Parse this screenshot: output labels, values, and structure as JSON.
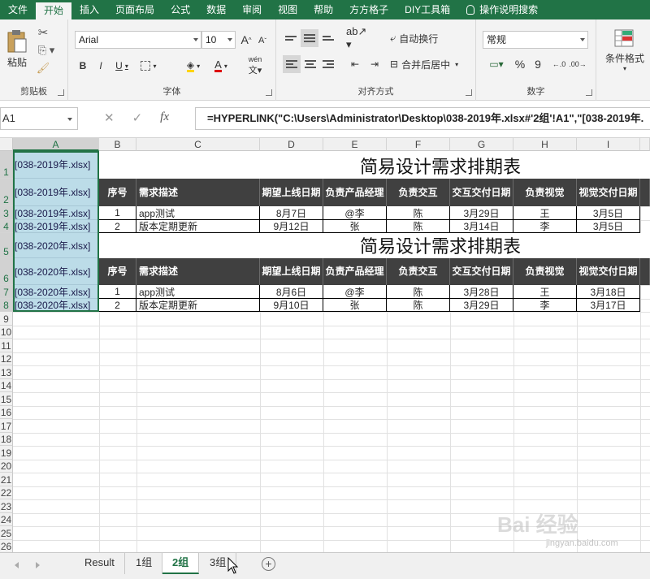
{
  "ribbon_tabs": [
    "文件",
    "开始",
    "插入",
    "页面布局",
    "公式",
    "数据",
    "审阅",
    "视图",
    "帮助",
    "方方格子",
    "DIY工具箱",
    "操作说明搜索"
  ],
  "ribbon": {
    "clipboard": {
      "paste": "粘贴",
      "label": "剪贴板"
    },
    "font": {
      "name": "Arial",
      "size": "10",
      "grow": "A",
      "shrink": "A",
      "bold": "B",
      "italic": "I",
      "underline": "U",
      "label": "字体",
      "phonetic": "wén"
    },
    "alignment": {
      "wrap": "自动换行",
      "merge": "合并后居中",
      "label": "对齐方式"
    },
    "number": {
      "format": "常规",
      "percent": "%",
      "comma": "9",
      "label": "数字"
    },
    "styles": {
      "conditional": "条件格式"
    }
  },
  "formula_bar": {
    "name_box": "A1",
    "fx": "fx",
    "formula": "=HYPERLINK(\"C:\\Users\\Administrator\\Desktop\\038-2019年.xlsx#'2组'!A1\",\"[038-2019年."
  },
  "columns": [
    "A",
    "B",
    "C",
    "D",
    "E",
    "F",
    "G",
    "H",
    "I"
  ],
  "rows": [
    "1",
    "2",
    "3",
    "4",
    "5",
    "6",
    "7",
    "8",
    "9",
    "10",
    "11",
    "12",
    "13",
    "14",
    "15",
    "16",
    "17",
    "18",
    "19",
    "20",
    "21",
    "22",
    "23",
    "24",
    "25",
    "26"
  ],
  "col_a": [
    "[038-2019年.xlsx]",
    "[038-2019年.xlsx]",
    "[038-2019年.xlsx]",
    "[038-2019年.xlsx]",
    "[038-2020年.xlsx]",
    "[038-2020年.xlsx]",
    "[038-2020年.xlsx]",
    "[038-2020年.xlsx]"
  ],
  "tables": [
    {
      "title": "简易设计需求排期表",
      "headers": [
        "序号",
        "需求描述",
        "期望上线日期",
        "负责产品经理",
        "负责交互",
        "交互交付日期",
        "负责视觉",
        "视觉交付日期"
      ],
      "rows": [
        [
          "1",
          "app测试",
          "8月7日",
          "@李",
          "陈",
          "3月29日",
          "王",
          "3月5日"
        ],
        [
          "2",
          "版本定期更新",
          "9月12日",
          "张",
          "陈",
          "3月14日",
          "李",
          "3月5日"
        ]
      ]
    },
    {
      "title": "简易设计需求排期表",
      "headers": [
        "序号",
        "需求描述",
        "期望上线日期",
        "负责产品经理",
        "负责交互",
        "交互交付日期",
        "负责视觉",
        "视觉交付日期"
      ],
      "rows": [
        [
          "1",
          "app测试",
          "8月6日",
          "@李",
          "陈",
          "3月28日",
          "王",
          "3月18日"
        ],
        [
          "2",
          "版本定期更新",
          "9月10日",
          "张",
          "陈",
          "3月29日",
          "李",
          "3月17日"
        ]
      ]
    }
  ],
  "sheet_tabs": [
    "Result",
    "1组",
    "2组",
    "3组"
  ],
  "active_sheet": "2组",
  "watermark": {
    "text": "Bai 经验",
    "url": "jingyan.baidu.com"
  },
  "colors": {
    "excel_green": "#217346",
    "header_dark": "#404040",
    "selection_blue": "#bcdce8"
  }
}
